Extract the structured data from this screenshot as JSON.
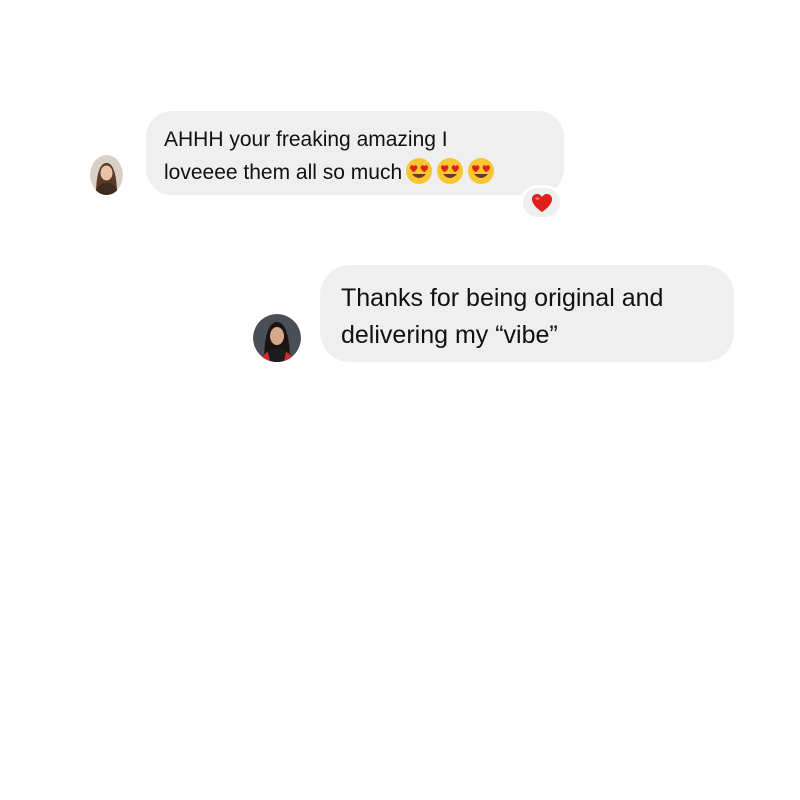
{
  "thread": {
    "messages": [
      {
        "sender": "other",
        "lines": [
          "AHHH your freaking amazing I",
          "loveeee them all so much"
        ],
        "emojis": [
          "smiling-face-with-heart-eyes",
          "smiling-face-with-heart-eyes",
          "smiling-face-with-heart-eyes"
        ],
        "reaction": "red-heart"
      },
      {
        "sender": "me",
        "lines": [
          "Thanks for being original and",
          "delivering my “vibe”"
        ]
      }
    ]
  },
  "colors": {
    "bubble": "#efefef",
    "background": "#ffffff",
    "text": "#111111",
    "heart": "#e0201c",
    "emoji_face": "#f9c531"
  }
}
